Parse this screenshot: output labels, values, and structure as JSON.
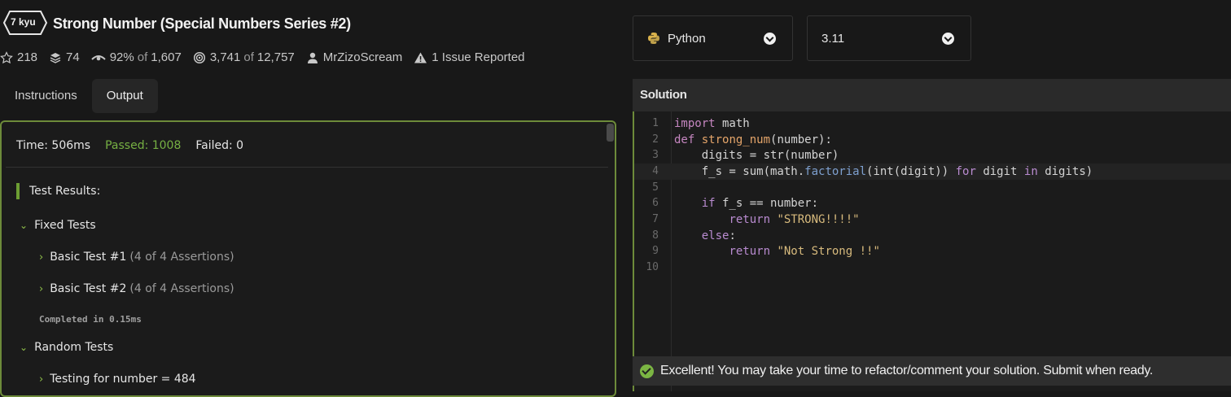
{
  "kata": {
    "rank": "7 kyu",
    "title": "Strong Number (Special Numbers Series #2)"
  },
  "stats": {
    "stars": "218",
    "collections": "74",
    "satisfaction": "92%",
    "satisfaction_of": "of",
    "satisfaction_votes": "1,607",
    "completed": "3,741",
    "completed_of": "of",
    "attempted": "12,757",
    "author": "MrZizoScream",
    "issues": "1 Issue Reported"
  },
  "tabs": [
    {
      "label": "Instructions",
      "active": false
    },
    {
      "label": "Output",
      "active": true
    }
  ],
  "output": {
    "time": "Time: 506ms",
    "passed": "Passed: 1008",
    "failed": "Failed: 0",
    "results_heading": "Test Results:",
    "groups": [
      {
        "label": "Fixed Tests"
      },
      {
        "label": "Random Tests"
      }
    ],
    "tests": [
      {
        "label": "Basic Test #1",
        "assertions": "(4 of 4 Assertions)"
      },
      {
        "label": "Basic Test #2",
        "assertions": "(4 of 4 Assertions)"
      },
      {
        "label": "Testing for number = 484",
        "assertions": ""
      }
    ],
    "completed": "Completed in 0.15ms"
  },
  "language": {
    "selected": "Python",
    "icon": "python-icon"
  },
  "version": {
    "selected": "3.11"
  },
  "solution": {
    "header": "Solution",
    "line_numbers": [
      "1",
      "2",
      "3",
      "4",
      "5",
      "6",
      "7",
      "8",
      "9",
      "10"
    ],
    "active_line": 4
  },
  "banner": {
    "text": "Excellent! You may take your time to refactor/comment your solution. Submit when ready."
  },
  "colors": {
    "accent_green": "#6d8b3a",
    "passed_green": "#76b043",
    "background": "#181818"
  }
}
